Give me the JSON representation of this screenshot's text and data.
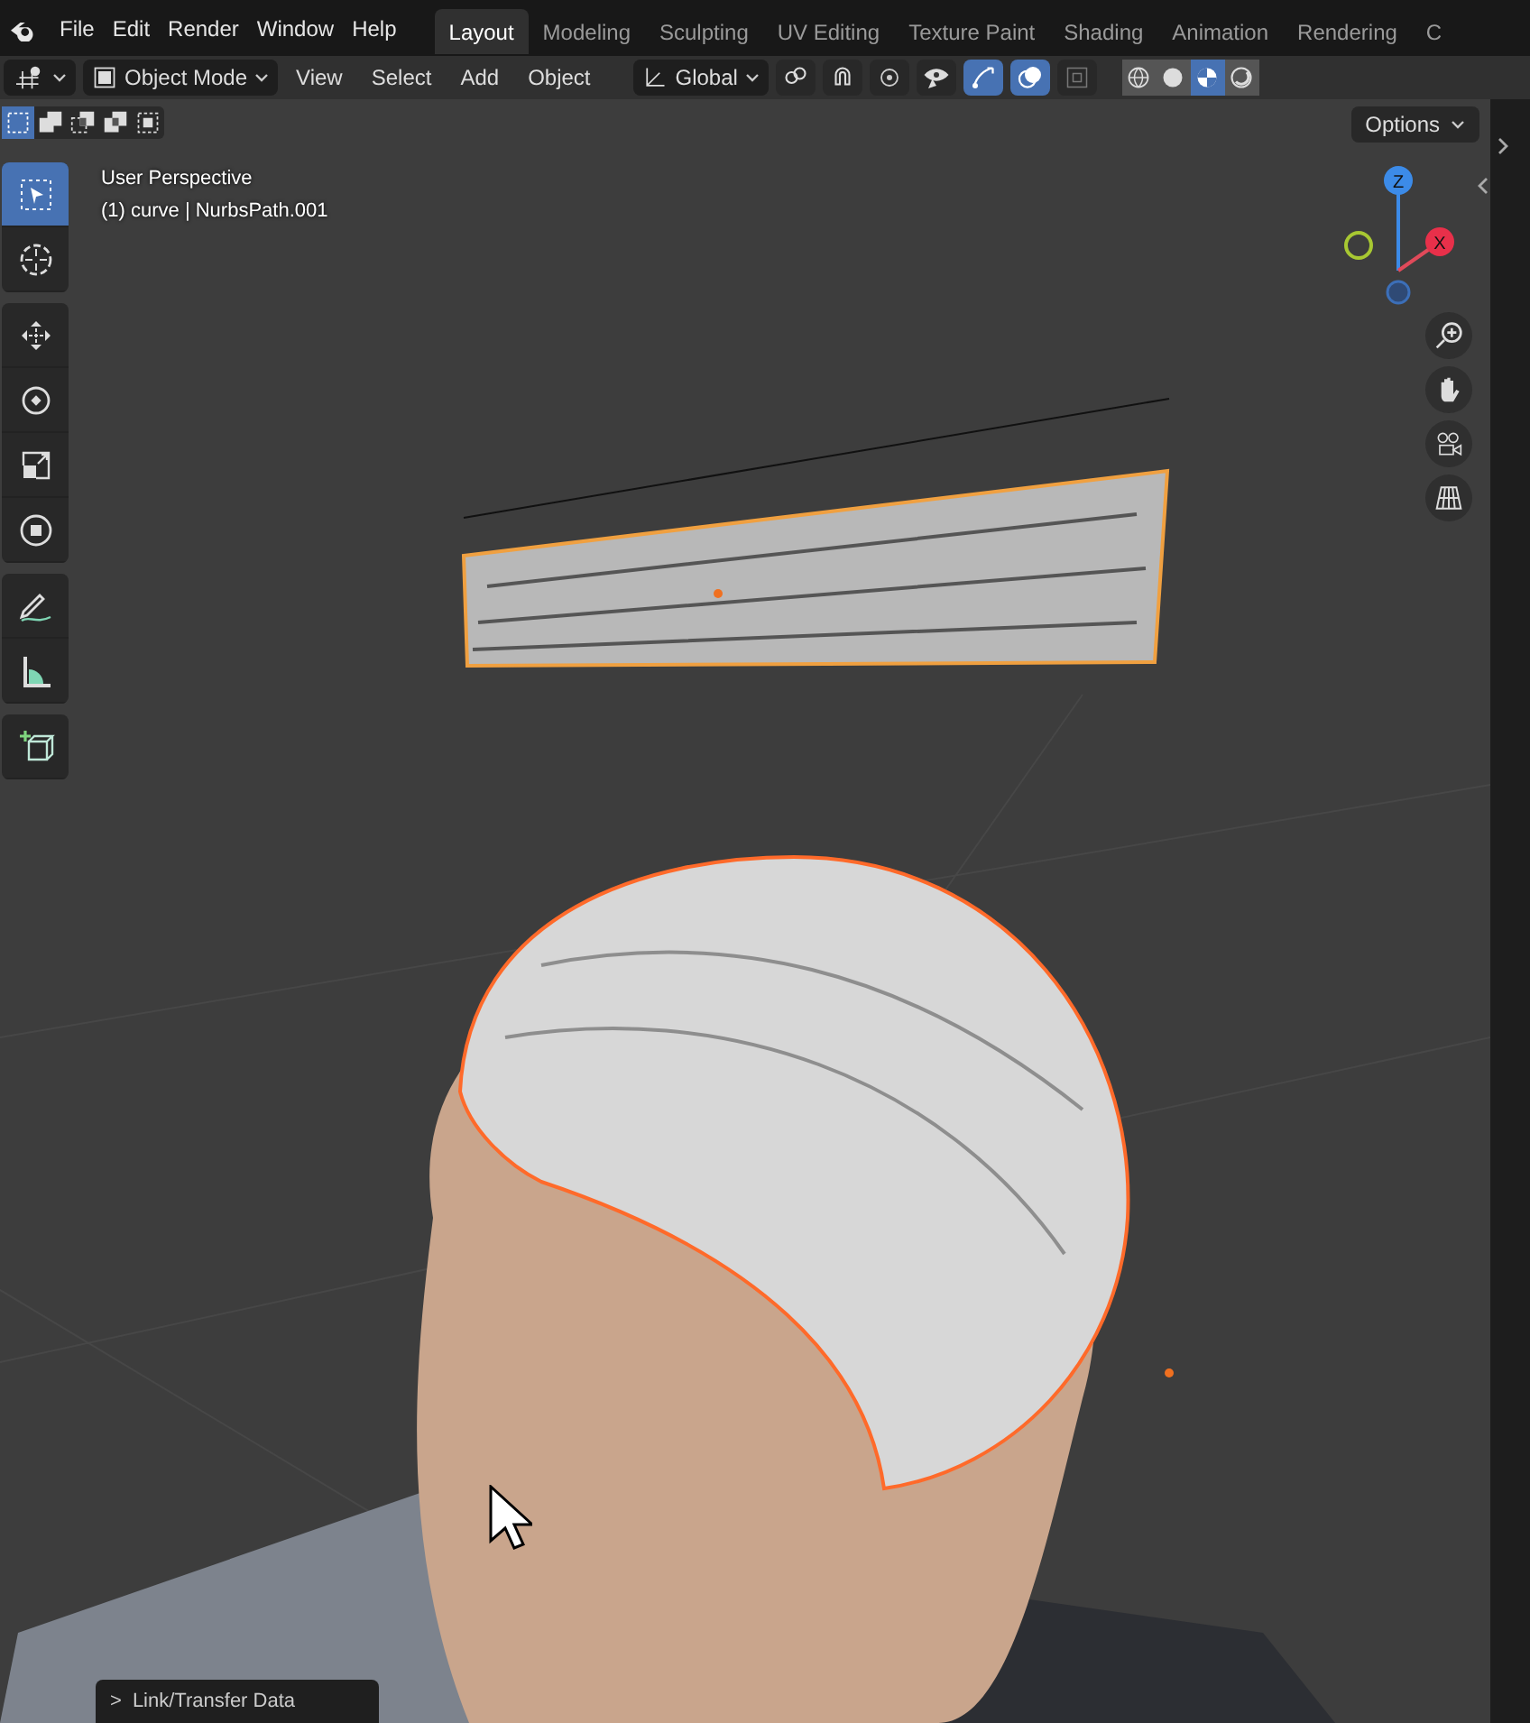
{
  "menu_bar": {
    "menus": [
      "File",
      "Edit",
      "Render",
      "Window",
      "Help"
    ],
    "workspaces": [
      {
        "label": "Layout",
        "selected": true
      },
      {
        "label": "Modeling",
        "selected": false
      },
      {
        "label": "Sculpting",
        "selected": false
      },
      {
        "label": "UV Editing",
        "selected": false
      },
      {
        "label": "Texture Paint",
        "selected": false
      },
      {
        "label": "Shading",
        "selected": false
      },
      {
        "label": "Animation",
        "selected": false
      },
      {
        "label": "Rendering",
        "selected": false
      },
      {
        "label": "C",
        "selected": false
      }
    ]
  },
  "header": {
    "mode": "Object Mode",
    "menus": [
      "View",
      "Select",
      "Add",
      "Object"
    ],
    "orientation": "Global",
    "toggles": [
      {
        "kind": "pivot",
        "on": false
      },
      {
        "kind": "snap",
        "on": false
      },
      {
        "kind": "proportional",
        "on": false
      },
      {
        "kind": "visibility",
        "on": false
      },
      {
        "kind": "gizmos",
        "on": true
      },
      {
        "kind": "overlays",
        "on": true
      },
      {
        "kind": "xray",
        "on": false
      }
    ],
    "shading": [
      {
        "kind": "wireframe",
        "selected": false
      },
      {
        "kind": "solid",
        "selected": false
      },
      {
        "kind": "material",
        "selected": true
      },
      {
        "kind": "rendered",
        "selected": false
      }
    ]
  },
  "viewport": {
    "select_modes": [
      {
        "selected": true
      },
      {
        "selected": false
      },
      {
        "selected": false
      },
      {
        "selected": false
      },
      {
        "selected": false
      }
    ],
    "options": "Options",
    "info": [
      "User Perspective",
      "(1) curve | NurbsPath.001"
    ],
    "toolbar": [
      {
        "tools": [
          {
            "kind": "select",
            "selected": true
          },
          {
            "kind": "cursor",
            "selected": false
          }
        ]
      },
      {
        "tools": [
          {
            "kind": "move",
            "selected": false
          },
          {
            "kind": "rotate",
            "selected": false
          },
          {
            "kind": "scale",
            "selected": false
          },
          {
            "kind": "transform",
            "selected": false
          }
        ]
      },
      {
        "tools": [
          {
            "kind": "annotate",
            "selected": false
          },
          {
            "kind": "measure",
            "selected": false
          }
        ]
      },
      {
        "tools": [
          {
            "kind": "add_cube",
            "selected": false
          }
        ]
      }
    ],
    "gizmo": {
      "z": "Z",
      "x": "X"
    },
    "redo_panel": {
      "arrow": ">",
      "label": "Link/Transfer Data"
    }
  }
}
